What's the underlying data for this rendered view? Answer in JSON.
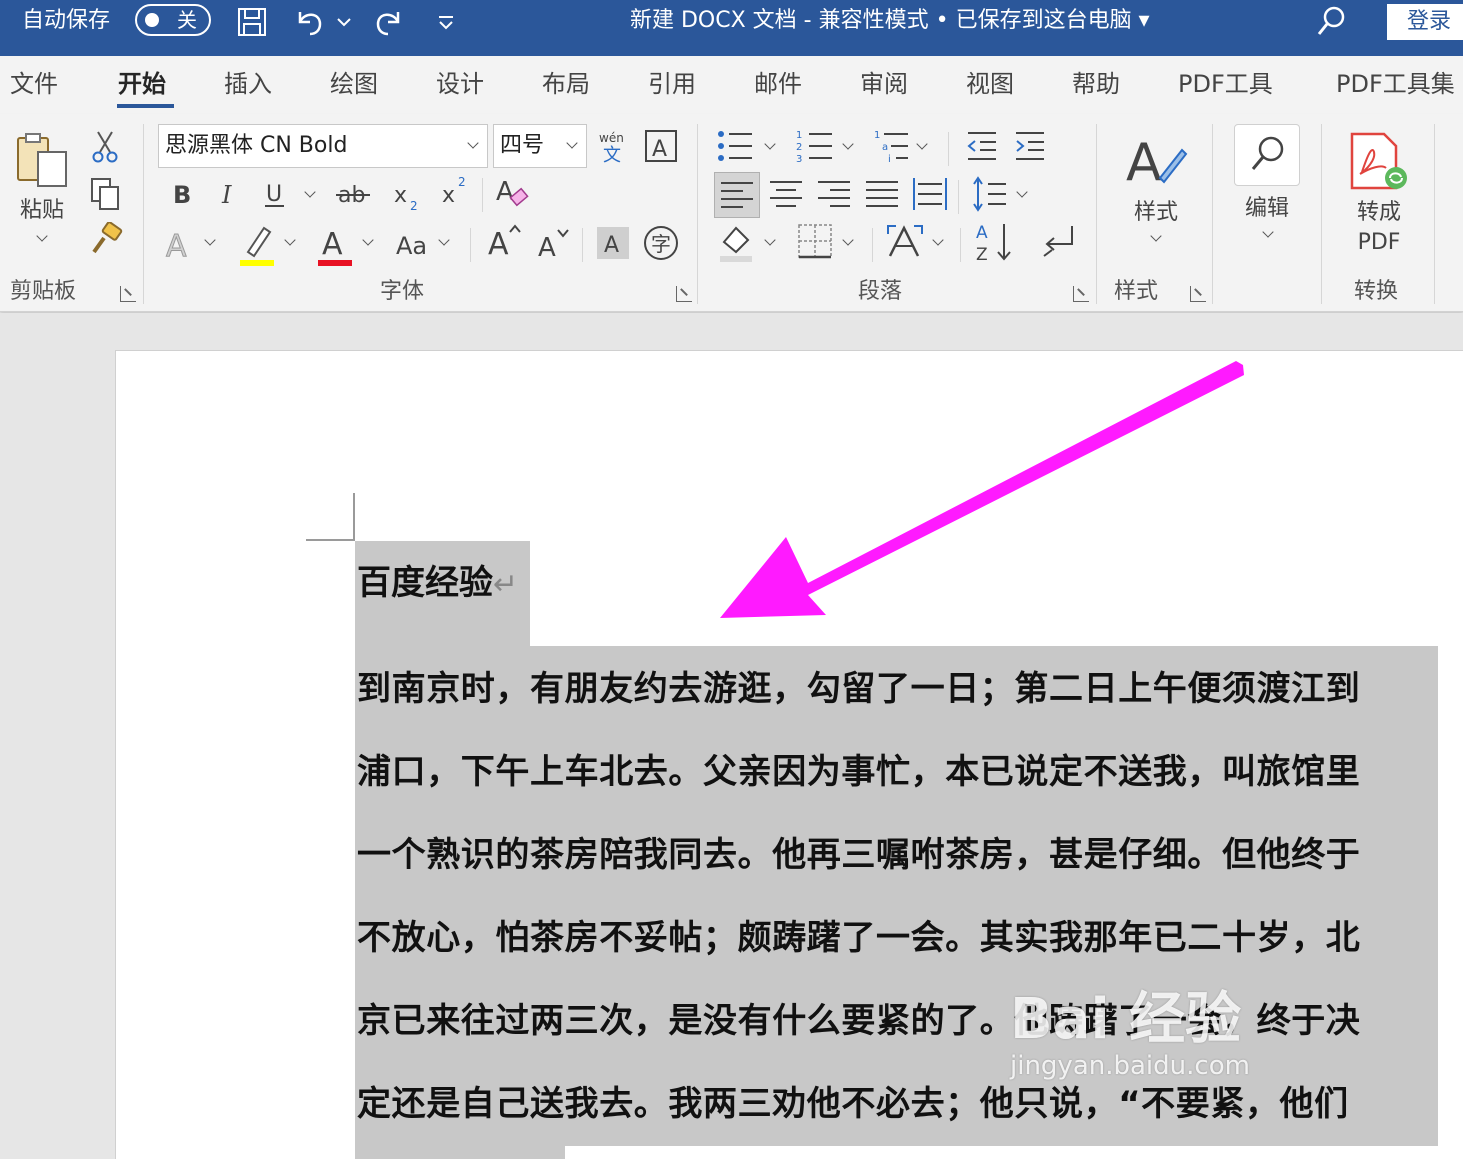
{
  "titlebar": {
    "autosave_label": "自动保存",
    "toggle_state": "关",
    "document_title": "新建 DOCX 文档  -  兼容性模式 • 已保存到这台电脑  ▾",
    "login_label": "登录"
  },
  "tabs": [
    "文件",
    "开始",
    "插入",
    "绘图",
    "设计",
    "布局",
    "引用",
    "邮件",
    "审阅",
    "视图",
    "帮助",
    "PDF工具",
    "PDF工具集"
  ],
  "active_tab": "开始",
  "ribbon": {
    "clipboard": {
      "paste_label": "粘贴",
      "group_label": "剪贴板"
    },
    "font": {
      "font_name": "思源黑体 CN Bold",
      "font_size": "四号",
      "group_label": "字体"
    },
    "paragraph": {
      "group_label": "段落"
    },
    "styles": {
      "styles_label": "样式",
      "group_label": "样式"
    },
    "editing": {
      "edit_label": "编辑"
    },
    "convert": {
      "convert_label_line1": "转成",
      "convert_label_line2": "PDF",
      "group_label": "转换"
    }
  },
  "document": {
    "heading": "百度经验",
    "lines": [
      "到南京时，有朋友约去游逛，勾留了一日；第二日上午便须渡江到",
      "浦口，下午上车北去。父亲因为事忙，本已说定不送我，叫旅馆里",
      "一个熟识的茶房陪我同去。他再三嘱咐茶房，甚是仔细。但他终于",
      "不放心，怕茶房不妥帖；颇踌躇了一会。其实我那年已二十岁，北",
      "京已来往过两三次，是没有什么要紧的了。他踌躇了一会，终于决",
      "定还是自己送我去。我两三劝他不必去；他只说，“不要紧，他们"
    ]
  },
  "watermark": {
    "main": "Bai 经验",
    "sub": "jingyan.baidu.com"
  },
  "colors": {
    "titlebar": "#2b579a",
    "selection": "#c8c8c8",
    "arrow": "#ff1aff",
    "highlight": "#ffff00",
    "font_color": "#e81123"
  }
}
